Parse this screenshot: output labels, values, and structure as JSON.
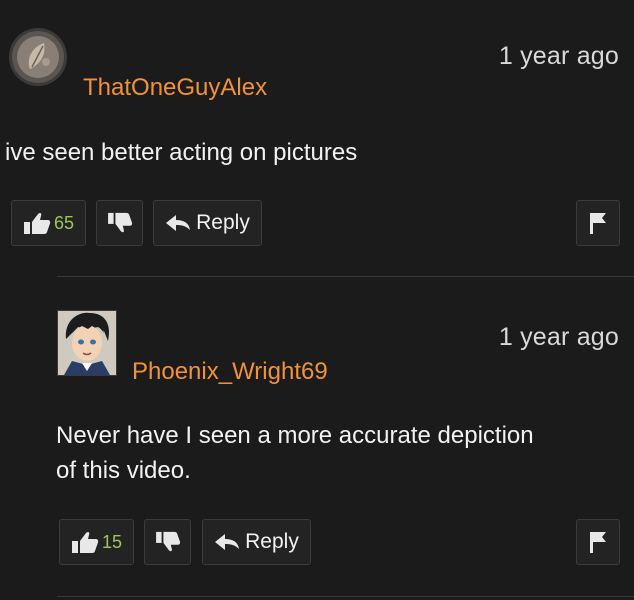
{
  "comments": [
    {
      "username": "ThatOneGuyAlex",
      "time": "1 year ago",
      "text": "ive seen better acting on pictures",
      "likes": "65",
      "reply_label": "Reply",
      "avatar_icon": "leaf-avatar-icon"
    },
    {
      "username": "Phoenix_Wright69",
      "time": "1 year ago",
      "text_line1": "Never have I seen a more accurate depiction",
      "text_line2": "of this video.",
      "likes": "15",
      "reply_label": "Reply",
      "avatar_icon": "anime-character-avatar-icon"
    }
  ],
  "colors": {
    "background": "#1b1b1b",
    "username": "#f0923a",
    "like_count": "#a0c45a"
  },
  "icons": [
    "thumbs-up-icon",
    "thumbs-down-icon",
    "reply-arrow-icon",
    "flag-icon"
  ]
}
